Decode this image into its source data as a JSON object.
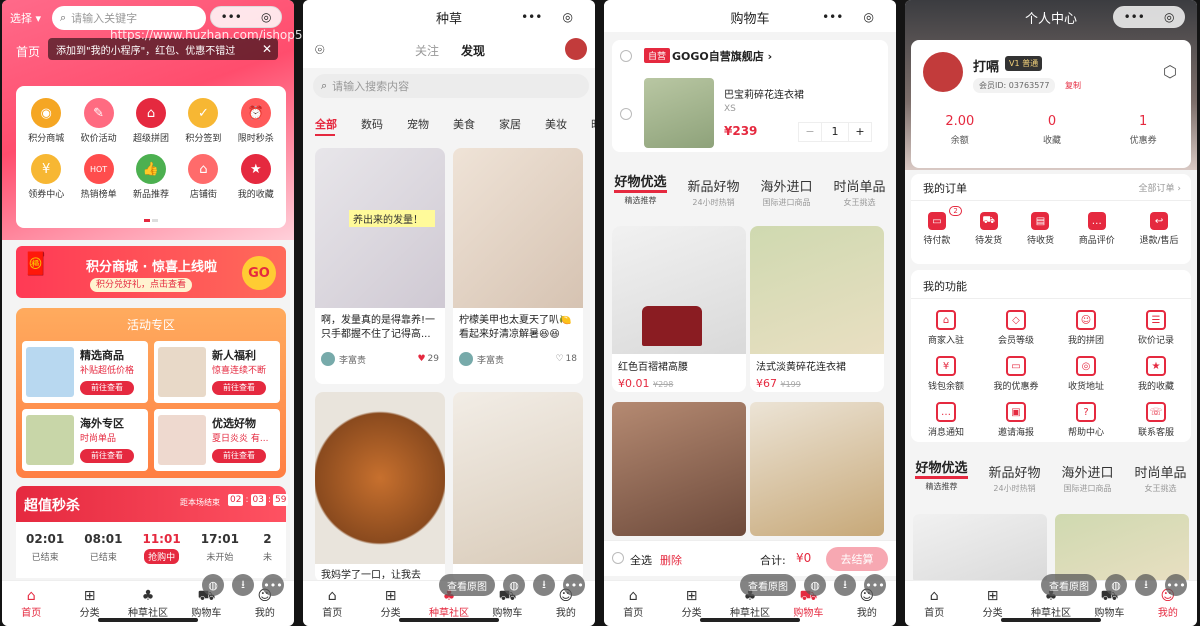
{
  "watermark": "https://www.huzhan.com/ishop52942",
  "s1": {
    "select": "选择",
    "search_placeholder": "请输入关键字",
    "home_tab": "首页",
    "tip": "添加到\"我的小程序\"，红包、优惠不错过",
    "grid": [
      "积分商城",
      "砍价活动",
      "超级拼团",
      "积分签到",
      "限时秒杀",
      "领券中心",
      "热销榜单",
      "新品推荐",
      "店铺街",
      "我的收藏"
    ],
    "banner_title": "积分商城 · 惊喜上线啦",
    "banner_sub": "积分兑好礼，点击查看",
    "banner_go": "GO",
    "activity_title": "活动专区",
    "activities": [
      {
        "title": "精选商品",
        "sub": "补贴超低价格",
        "btn": "前往查看"
      },
      {
        "title": "新人福利",
        "sub": "惊喜连续不断",
        "btn": "前往查看"
      },
      {
        "title": "海外专区",
        "sub": "时尚单品",
        "btn": "前往查看"
      },
      {
        "title": "优选好物",
        "sub": "夏日炎炎 有...",
        "btn": "前往查看"
      }
    ],
    "seckill_title": "超值秒杀",
    "seckill_end": "距本场结束",
    "timer": [
      "02",
      "03",
      "59"
    ],
    "sessions": [
      {
        "time": "02:01",
        "status": "已结束"
      },
      {
        "time": "08:01",
        "status": "已结束"
      },
      {
        "time": "11:01",
        "status": "抢购中"
      },
      {
        "time": "17:01",
        "status": "未开始"
      },
      {
        "time": "2",
        "status": "未"
      }
    ]
  },
  "s2": {
    "title": "种草",
    "follow": "关注",
    "discover": "发现",
    "search_placeholder": "请输入搜索内容",
    "cats": [
      "全部",
      "数码",
      "宠物",
      "美食",
      "家居",
      "美妆",
      "时尚"
    ],
    "posts": [
      {
        "overlay": "养出来的发量！",
        "text": "啊，发量真的是得靠养!一只手都握不住了记得高...",
        "author": "李富贵",
        "likes": "29"
      },
      {
        "text": "柠檬美甲也太夏天了叭🍋看起来好清凉解暑😆😆",
        "author": "李富贵",
        "likes": "18"
      }
    ],
    "bottom_snip": "我妈学了一口，让我去小..."
  },
  "s3": {
    "title": "购物车",
    "store_tag": "自营",
    "store_name": "GOGO自营旗舰店",
    "item_name": "巴宝莉碎花连衣裙",
    "item_spec": "XS",
    "item_price": "¥239",
    "qty": "1",
    "cats": [
      {
        "t": "好物优选",
        "s": "精选推荐"
      },
      {
        "t": "新品好物",
        "s": "24小时热销"
      },
      {
        "t": "海外进口",
        "s": "国际进口商品"
      },
      {
        "t": "时尚单品",
        "s": "女王挑选"
      }
    ],
    "products": [
      {
        "name": "红色百褶裙高腰",
        "price": "¥0.01",
        "orig": "¥298"
      },
      {
        "name": "法式淡黄碎花连衣裙",
        "price": "¥67",
        "orig": "¥199"
      }
    ],
    "select_all": "全选",
    "delete": "删除",
    "total_label": "合计:",
    "total": "¥0",
    "checkout": "去结算"
  },
  "s4": {
    "title": "个人中心",
    "nickname": "打嗝",
    "level": "V1 普通",
    "member_id": "会员ID: 03763577",
    "copy": "复制",
    "stats": [
      {
        "v": "2.00",
        "l": "余额"
      },
      {
        "v": "0",
        "l": "收藏"
      },
      {
        "v": "1",
        "l": "优惠券"
      }
    ],
    "orders_title": "我的订单",
    "orders_all": "全部订单",
    "orders": [
      "待付款",
      "待发货",
      "待收货",
      "商品评价",
      "退款/售后"
    ],
    "pay_badge": "2",
    "func_title": "我的功能",
    "funcs": [
      "商家入驻",
      "会员等级",
      "我的拼团",
      "砍价记录",
      "钱包余额",
      "我的优惠券",
      "收货地址",
      "我的收藏",
      "消息通知",
      "邀请海报",
      "帮助中心",
      "联系客服"
    ],
    "cats": [
      {
        "t": "好物优选",
        "s": "精选推荐"
      },
      {
        "t": "新品好物",
        "s": "24小时热销"
      },
      {
        "t": "海外进口",
        "s": "国际进口商品"
      },
      {
        "t": "时尚单品",
        "s": "女王挑选"
      }
    ]
  },
  "tabbar": [
    "首页",
    "分类",
    "种草社区",
    "购物车",
    "我的"
  ],
  "overlay": {
    "view_orig": "查看原图"
  }
}
